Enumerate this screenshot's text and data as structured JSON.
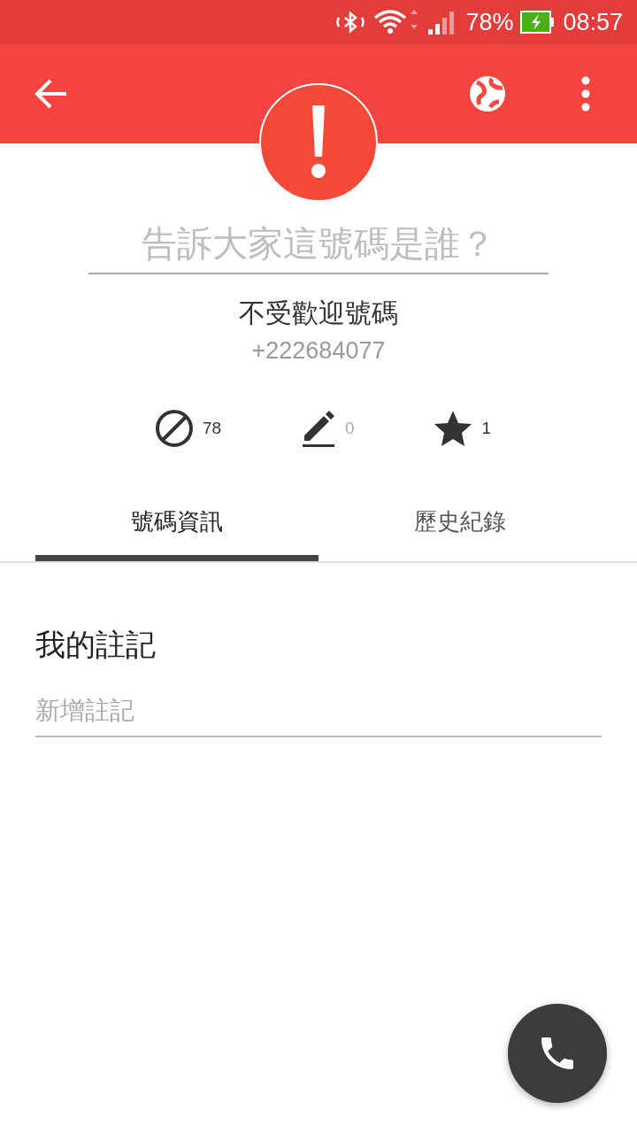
{
  "status_bar": {
    "battery": "78%",
    "time": "08:57"
  },
  "header": {
    "name_field": {
      "placeholder": "告訴大家這號碼是誰？"
    },
    "label": "不受歡迎號碼",
    "phone": "+222684077"
  },
  "stats": [
    {
      "kind": "block",
      "count": "78",
      "muted": false
    },
    {
      "kind": "edit",
      "count": "0",
      "muted": true
    },
    {
      "kind": "star",
      "count": "1",
      "muted": false
    }
  ],
  "tabs": [
    {
      "label": "號碼資訊",
      "selected": true
    },
    {
      "label": "歷史紀錄",
      "selected": false
    }
  ],
  "notes": {
    "title": "我的註記",
    "field": {
      "placeholder": "新增註記"
    }
  }
}
